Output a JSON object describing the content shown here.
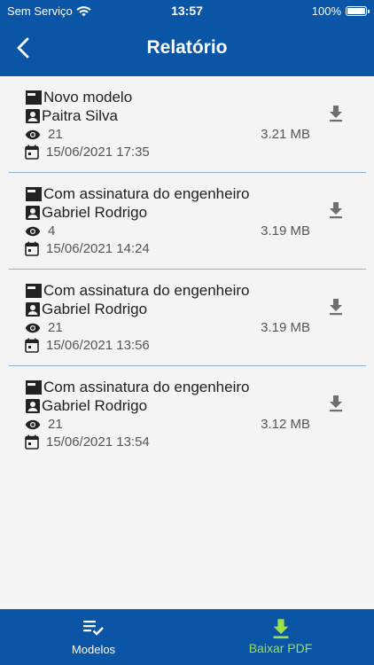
{
  "status": {
    "carrier": "Sem Serviço",
    "time": "13:57",
    "battery": "100%"
  },
  "header": {
    "title": "Relatório"
  },
  "reports": [
    {
      "title": "Novo modelo",
      "author": "Paitra Silva",
      "views": "21",
      "size": "3.21 MB",
      "date": "15/06/2021 17:35"
    },
    {
      "title": "Com assinatura do engenheiro",
      "author": "Gabriel Rodrigo",
      "views": "4",
      "size": "3.19 MB",
      "date": "15/06/2021 14:24"
    },
    {
      "title": "Com assinatura do engenheiro",
      "author": "Gabriel Rodrigo",
      "views": "21",
      "size": "3.19 MB",
      "date": "15/06/2021 13:56"
    },
    {
      "title": "Com assinatura do engenheiro",
      "author": "Gabriel Rodrigo",
      "views": "21",
      "size": "3.12 MB",
      "date": "15/06/2021 13:54"
    }
  ],
  "bottom_nav": {
    "modelos": {
      "label": "Modelos",
      "icon": "playlist-check-icon"
    },
    "baixar": {
      "label": "Baixar PDF",
      "icon": "download-icon",
      "active_color": "#9fe04a"
    }
  },
  "colors": {
    "primary": "#0a55a6",
    "background": "#f4f4f4",
    "divider": "#8fb0cc",
    "accent": "#9fe04a"
  }
}
